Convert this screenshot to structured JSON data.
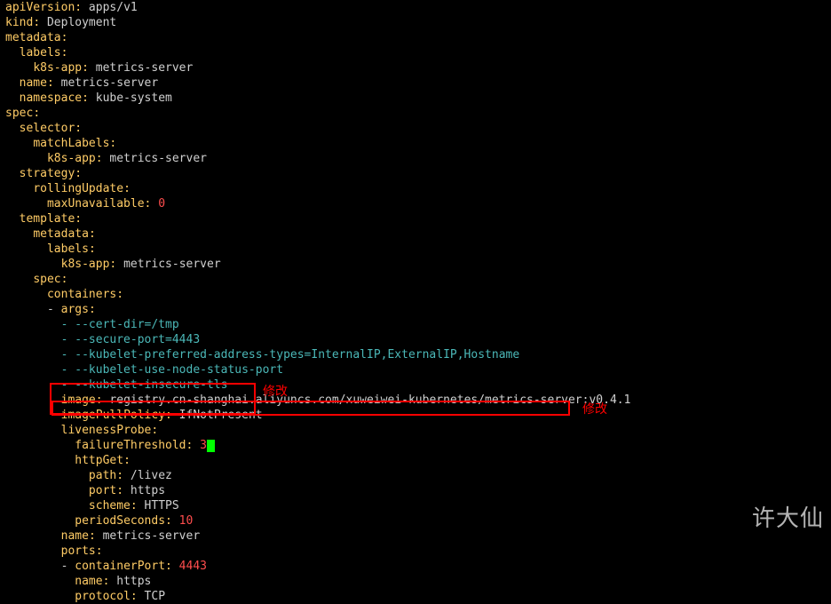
{
  "annotations": {
    "mod1": "修改",
    "mod2": "修改"
  },
  "watermark": "许大仙",
  "yaml": {
    "l1_k": "apiVersion",
    "l1_v": " apps/v1",
    "l2_k": "kind",
    "l2_v": " Deployment",
    "l3_k": "metadata",
    "l4_k": "labels",
    "l5_k": "k8s-app",
    "l5_v": " metrics-server",
    "l6_k": "name",
    "l6_v": " metrics-server",
    "l7_k": "namespace",
    "l7_v": " kube-system",
    "l8_k": "spec",
    "l9_k": "selector",
    "l10_k": "matchLabels",
    "l11_k": "k8s-app",
    "l11_v": " metrics-server",
    "l12_k": "strategy",
    "l13_k": "rollingUpdate",
    "l14_k": "maxUnavailable",
    "l14_v": " 0",
    "l15_k": "template",
    "l16_k": "metadata",
    "l17_k": "labels",
    "l18_k": "k8s-app",
    "l18_v": " metrics-server",
    "l19_k": "spec",
    "l20_k": "containers",
    "l21_k": "args",
    "l22": "        - --cert-dir=/tmp",
    "l23": "        - --secure-port=4443",
    "l24": "        - --kubelet-preferred-address-types=InternalIP,ExternalIP,Hostname",
    "l25": "        - --kubelet-use-node-status-port",
    "l26": "        - --kubelet-insecure-tls",
    "l27_k": "image",
    "l27_v": " registry.cn-shanghai.aliyuncs.com/xuweiwei-kubernetes/metrics-server:v0.4.1",
    "l28_k": "imagePullPolicy",
    "l28_v": " IfNotPresent",
    "l29_k": "livenessProbe",
    "l30_k": "failureThreshold",
    "l30_v": "3",
    "l31_k": "httpGet",
    "l32_k": "path",
    "l32_v": " /livez",
    "l33_k": "port",
    "l33_v": " https",
    "l34_k": "scheme",
    "l34_v": " HTTPS",
    "l35_k": "periodSeconds",
    "l35_v": " 10",
    "l36_k": "name",
    "l36_v": " metrics-server",
    "l37_k": "ports",
    "l38_k": "containerPort",
    "l38_v": " 4443",
    "l39_k": "name",
    "l39_v": " https",
    "l40_k": "protocol",
    "l40_v": " TCP"
  }
}
